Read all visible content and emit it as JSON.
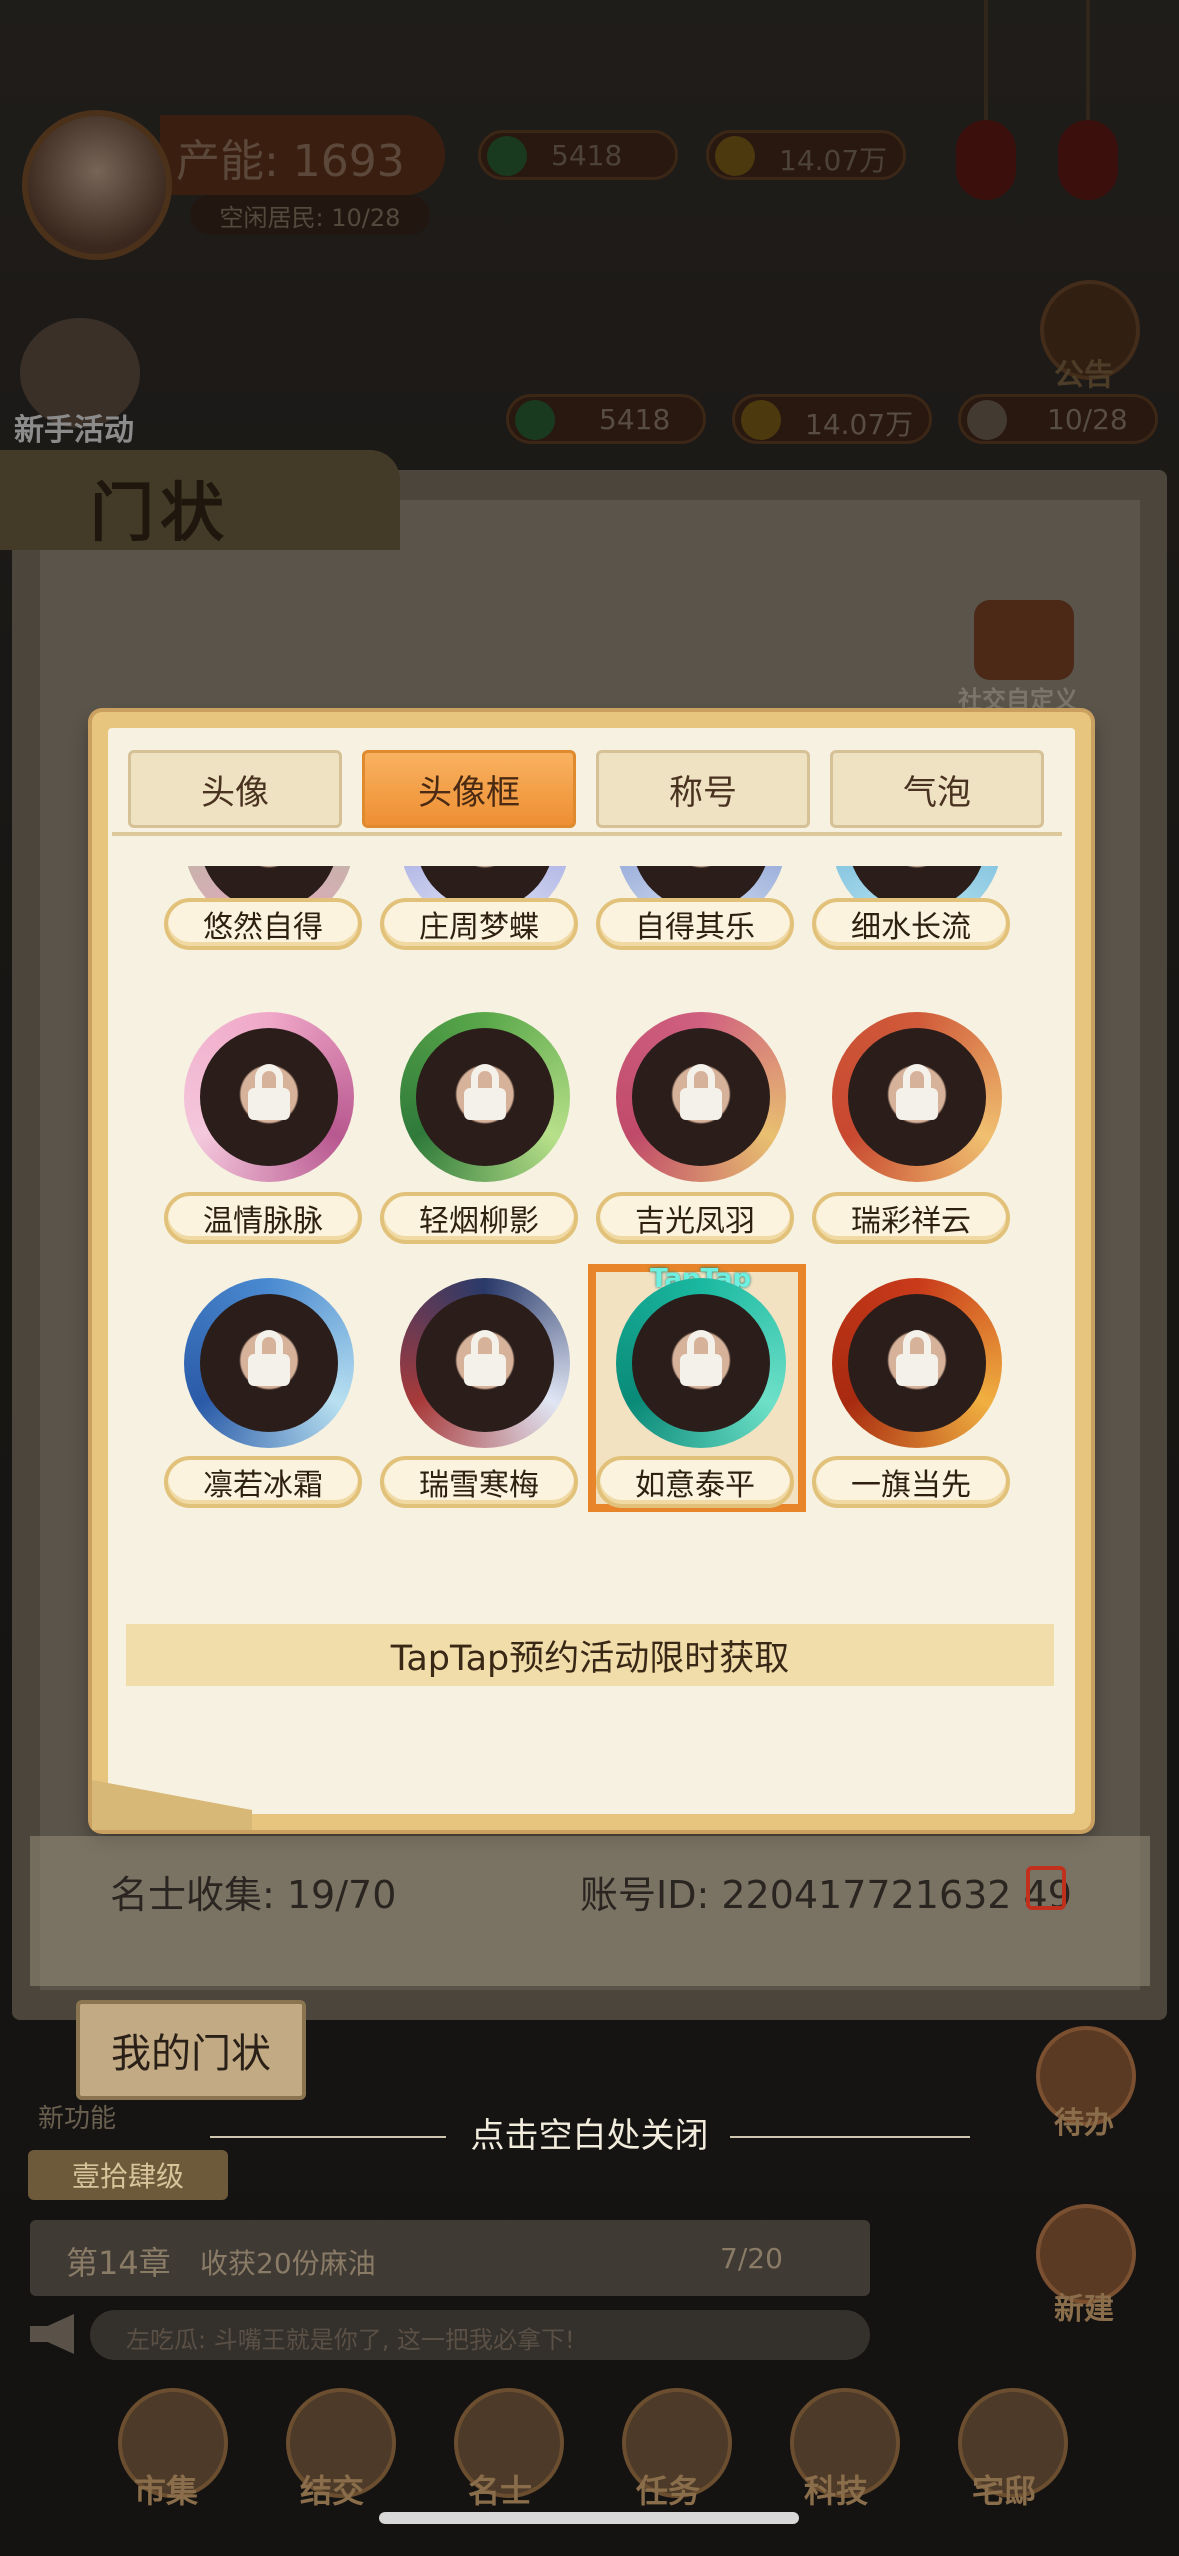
{
  "hud": {
    "production_label": "产能: 1693",
    "idle_residents": "空闲居民: 10/28",
    "currency_green_top": "5418",
    "currency_gold_top": "14.07万",
    "currency_green": "5418",
    "currency_gold": "14.07万",
    "residents": "10/28",
    "newbie_event": "新手活动",
    "announcement": "公告"
  },
  "card": {
    "title": "门状",
    "social_custom": "社交自定义",
    "collection_label": "名士收集: 19/70",
    "account_label": "账号ID: 220417721632 49"
  },
  "modal": {
    "tabs": [
      {
        "label": "头像",
        "active": false
      },
      {
        "label": "头像框",
        "active": true
      },
      {
        "label": "称号",
        "active": false
      },
      {
        "label": "气泡",
        "active": false
      }
    ],
    "rows": [
      [
        {
          "name": "悠然自得"
        },
        {
          "name": "庄周梦蝶"
        },
        {
          "name": "自得其乐"
        },
        {
          "name": "细水长流"
        }
      ],
      [
        {
          "name": "温情脉脉"
        },
        {
          "name": "轻烟柳影"
        },
        {
          "name": "吉光凤羽"
        },
        {
          "name": "瑞彩祥云"
        }
      ],
      [
        {
          "name": "凛若冰霜"
        },
        {
          "name": "瑞雪寒梅"
        },
        {
          "name": "如意泰平",
          "selected": true,
          "badge": "TapTap"
        },
        {
          "name": "一旗当先"
        }
      ]
    ],
    "hint": "TapTap预约活动限时获取"
  },
  "footer": {
    "my_card": "我的门状",
    "new_feature": "新功能",
    "close_hint": "点击空白处关闭",
    "chapter_tag": "壹拾肆级",
    "chapter": "第14章",
    "task": "收获20份麻油",
    "task_progress": "7/20",
    "chat": "左吃瓜: 斗嘴王就是你了, 这一把我必拿下!",
    "todo": "待办",
    "build": "新建",
    "nav": [
      "市集",
      "结交",
      "名士",
      "任务",
      "科技",
      "宅邸"
    ]
  },
  "colors": {
    "accent_orange": "#ee8f33",
    "selected_border": "#e8852a",
    "panel_bg": "#f6f1e0",
    "frame_gold": "#e7c57f"
  }
}
